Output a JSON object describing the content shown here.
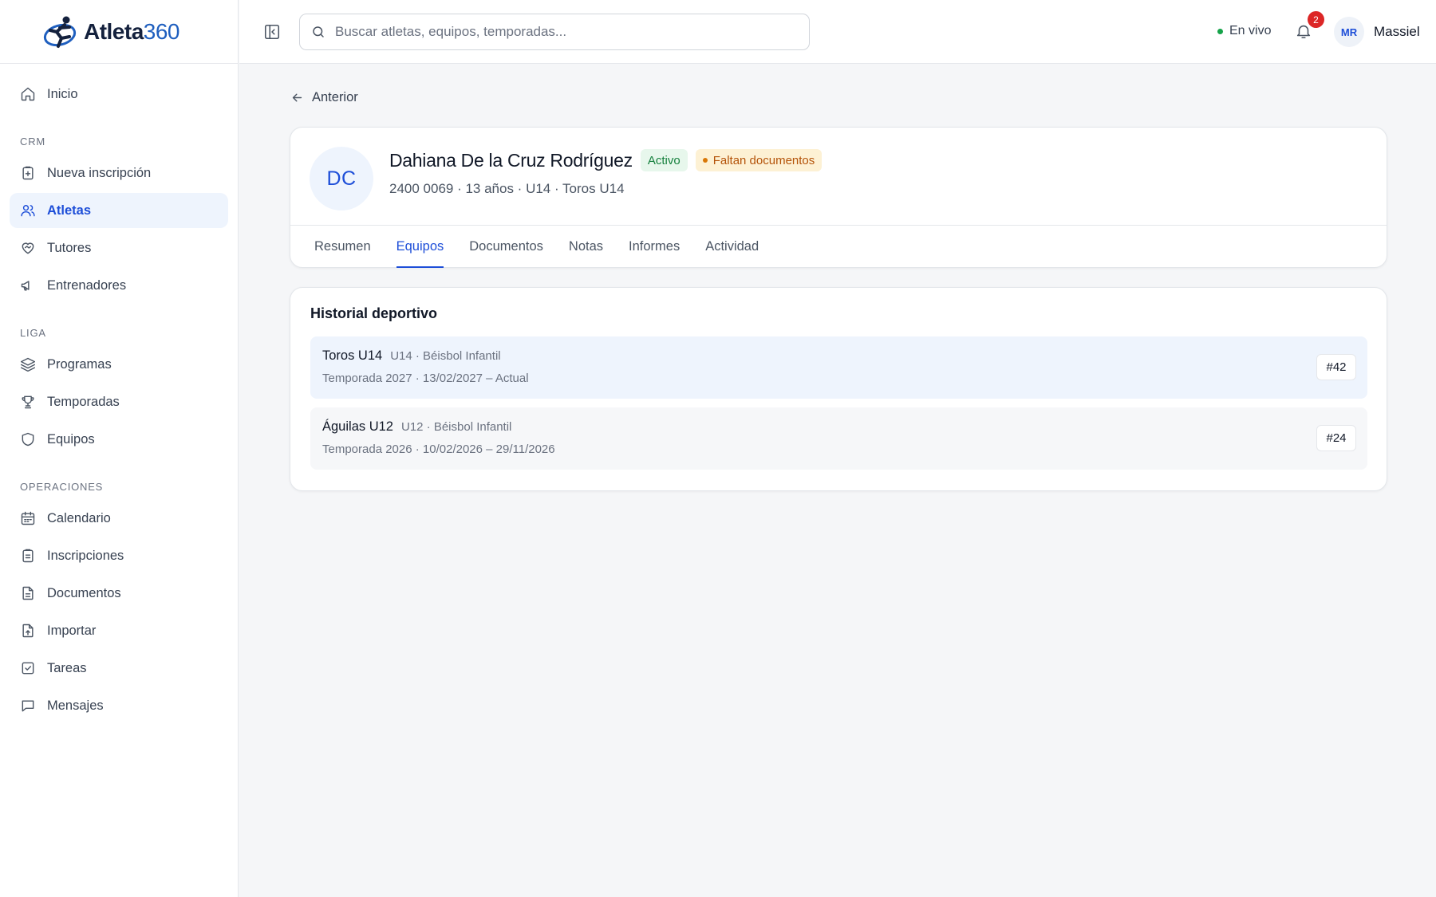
{
  "brand": {
    "name": "Atleta",
    "number": "360",
    "colors": {
      "primary": "#1d4ed8",
      "navy": "#14213d",
      "live": "#16a34a",
      "alert": "#dc2626"
    }
  },
  "topbar": {
    "search_placeholder": "Buscar atletas, equipos, temporadas...",
    "live_label": "En vivo",
    "notification_count": "2",
    "user_initials": "MR",
    "user_name": "Massiel"
  },
  "sidebar": {
    "home": "Inicio",
    "crm_label": "CRM",
    "crm": [
      "Nueva inscripción",
      "Atletas",
      "Tutores",
      "Entrenadores"
    ],
    "liga_label": "LIGA",
    "liga": [
      "Programas",
      "Temporadas",
      "Equipos"
    ],
    "ops_label": "OPERACIONES",
    "ops": [
      "Calendario",
      "Inscripciones",
      "Documentos",
      "Importar",
      "Tareas",
      "Mensajes"
    ],
    "active_item": "Atletas"
  },
  "page": {
    "back_label": "Anterior",
    "athlete": {
      "initials": "DC",
      "name": "Dahiana De la Cruz Rodríguez",
      "status": "Activo",
      "warning": "Faltan documentos",
      "meta": "2400 0069 · 13 años · U14 · Toros U14"
    },
    "tabs": [
      "Resumen",
      "Equipos",
      "Documentos",
      "Notas",
      "Informes",
      "Actividad"
    ],
    "active_tab": "Equipos",
    "history": {
      "title": "Historial deportivo",
      "rows": [
        {
          "team": "Toros U14",
          "sub": "U14 · Béisbol Infantil",
          "season": "Temporada 2027 · 13/02/2027 – Actual",
          "jersey": "#42",
          "current": true
        },
        {
          "team": "Águilas U12",
          "sub": "U12 · Béisbol Infantil",
          "season": "Temporada 2026 · 10/02/2026 – 29/11/2026",
          "jersey": "#24",
          "current": false
        }
      ]
    }
  }
}
